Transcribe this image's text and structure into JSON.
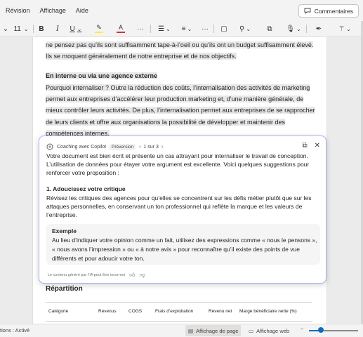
{
  "menubar": {
    "items": [
      "Révision",
      "Affichage",
      "Aide"
    ],
    "comments_label": "Commentaires"
  },
  "toolbar": {
    "font_size": "11",
    "bold": "B",
    "italic": "I",
    "underline": "U",
    "more": "···"
  },
  "doc": {
    "para1": "ne pensez pas qu’ils sont suffisamment tape-à-l’oeil ou qu’ils ont un budget suffisamment élevé. Ils se moquent généralement de notre entreprise et de nos objectifs.",
    "heading1": "En interne ou via une agence externe",
    "para2": "Pourquoi internaliser ? Outre la réduction des coûts, l’internalisation des activités de marketing permet aux entreprises d’accélérer leur production marketing et, d’une manière générale, de mieux contrôler leurs activités. De plus, l’internalisation permet aux entreprises de se rapprocher de leurs clients et offre aux organisations la possibilité de développer et maintenir des compétences internes.",
    "heading2": "Répartition",
    "table_headers": [
      "Catégorie",
      "Revenus",
      "COGS",
      "Frais d’exploitation",
      "Revenu net",
      "Marge bénéficiaire nette (%)"
    ]
  },
  "copilot": {
    "title": "Coaching avec Copilot",
    "badge": "Préversion",
    "pager": "1 sur 3",
    "intro": "Votre document est bien écrit et présente un cas attrayant pour internaliser le travail de conception. L’utilisation de données pour étayer votre argument est excellente. Voici quelques suggestions pour renforcer votre proposition :",
    "section_title": "1. Adoucissez votre critique",
    "section_text": "Révisez les critiques des agences pour qu’elles se concentrent sur les défis métier plutôt que sur les attaques personnelles, en conservant un ton professionnel qui reflète la marque et les valeurs de l’entreprise.",
    "example_title": "Exemple",
    "example_text": "Au lieu d’indiquer votre opinion comme un fait, utilisez des expressions comme « nous le pensons », « nous avons l’impression » ou « à notre avis » pour reconnaître qu’il existe des points de vue différents et pour adoucir votre ton.",
    "footer": "Le contenu généré par l’IA peut être incorrect"
  },
  "statusbar": {
    "left": "tions : Activé",
    "page_view": "Affichage de page",
    "web_view": "Affichage web",
    "zoom_level": 0.24
  },
  "colors": {
    "accent": "#0f6cbd",
    "copilot_border": "#a7b6f5",
    "highlight": "#ffeb3b",
    "font_color": "#d13438"
  }
}
